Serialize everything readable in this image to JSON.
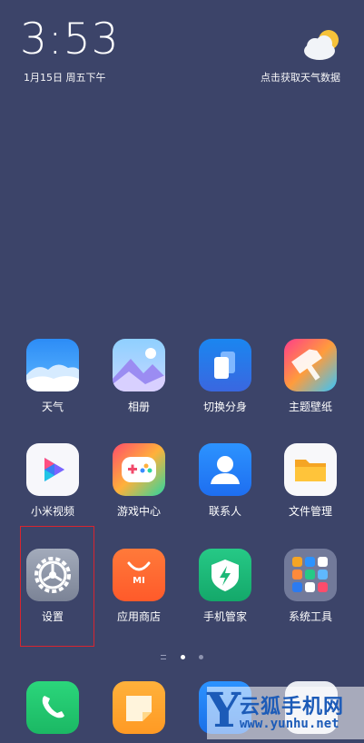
{
  "status": {
    "time": "3:53",
    "date": "1月15日 周五下午",
    "weather_prompt": "点击获取天气数据"
  },
  "apps": [
    {
      "label": "天气",
      "icon": "weather-icon"
    },
    {
      "label": "相册",
      "icon": "gallery-icon"
    },
    {
      "label": "切换分身",
      "icon": "second-space-icon"
    },
    {
      "label": "主题壁纸",
      "icon": "themes-icon"
    },
    {
      "label": "小米视频",
      "icon": "video-icon"
    },
    {
      "label": "游戏中心",
      "icon": "game-center-icon"
    },
    {
      "label": "联系人",
      "icon": "contacts-icon"
    },
    {
      "label": "文件管理",
      "icon": "file-manager-icon"
    },
    {
      "label": "设置",
      "icon": "settings-icon"
    },
    {
      "label": "应用商店",
      "icon": "app-store-icon"
    },
    {
      "label": "手机管家",
      "icon": "security-icon"
    },
    {
      "label": "系统工具",
      "icon": "system-tools-folder-icon"
    }
  ],
  "dock": [
    {
      "icon": "phone-icon"
    },
    {
      "icon": "notes-icon"
    },
    {
      "icon": "browser-icon"
    },
    {
      "icon": "camera-icon"
    }
  ],
  "watermark": {
    "letter": "Y",
    "name": "云狐手机网",
    "url": "www.yunhu.net"
  },
  "page_indicator": {
    "pages": 2,
    "active": 1
  },
  "colors": {
    "background": "#3c4469",
    "highlight": "#d8252f",
    "watermark": "#1c5bb8"
  }
}
